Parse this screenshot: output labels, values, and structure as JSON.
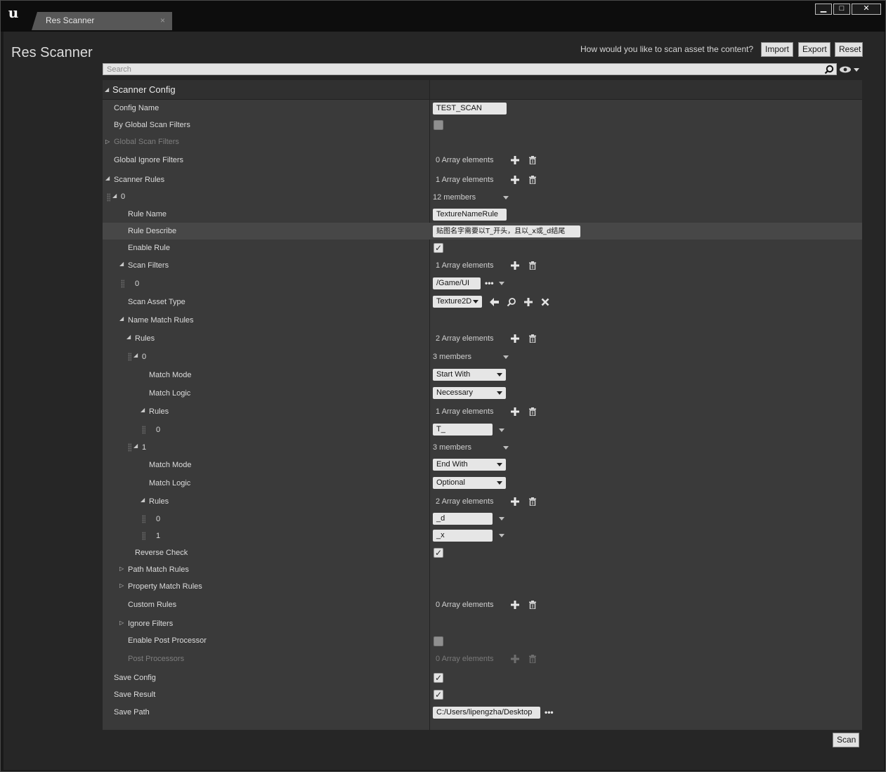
{
  "window": {
    "tab_title": "Res Scanner",
    "tab_close": "×",
    "controls": {
      "minimize": "▁",
      "maximize": "□",
      "close": "✕"
    },
    "logo": "u"
  },
  "header": {
    "title": "Res Scanner",
    "question": "How would you like to scan asset the content?",
    "import_label": "Import",
    "export_label": "Export",
    "reset_label": "Reset"
  },
  "search": {
    "placeholder": "Search",
    "value": ""
  },
  "panel": {
    "section_title": "Scanner Config",
    "config_name": {
      "label": "Config Name",
      "value": "TEST_SCAN"
    },
    "by_global_scan_filters": {
      "label": "By Global Scan Filters",
      "checked": false
    },
    "global_scan_filters": {
      "label": "Global Scan Filters"
    },
    "global_ignore_filters": {
      "label": "Global Ignore Filters",
      "value": "0 Array elements"
    },
    "scanner_rules": {
      "label": "Scanner Rules",
      "value": "1 Array elements"
    },
    "rule0": {
      "index": "0",
      "members": "12 members",
      "rule_name": {
        "label": "Rule Name",
        "value": "TextureNameRule"
      },
      "rule_describe": {
        "label": "Rule Describe",
        "value": "贴图名字需要以T_开头，且以_x或_d结尾"
      },
      "enable_rule": {
        "label": "Enable Rule",
        "checked": true
      },
      "scan_filters": {
        "label": "Scan Filters",
        "value": "1 Array elements",
        "item_index": "0",
        "item_value": "/Game/UI"
      },
      "scan_asset_type": {
        "label": "Scan Asset Type",
        "value": "Texture2D"
      },
      "name_match_rules": {
        "label": "Name Match Rules",
        "rules_label": "Rules",
        "rules_value": "2 Array elements",
        "items": [
          {
            "index": "0",
            "members": "3 members",
            "match_mode_label": "Match Mode",
            "match_mode": "Start With",
            "match_logic_label": "Match Logic",
            "match_logic": "Necessary",
            "rules_label": "Rules",
            "rules_value": "1 Array elements",
            "rules": [
              {
                "index": "0",
                "value": "T_"
              }
            ]
          },
          {
            "index": "1",
            "members": "3 members",
            "match_mode_label": "Match Mode",
            "match_mode": "End With",
            "match_logic_label": "Match Logic",
            "match_logic": "Optional",
            "rules_label": "Rules",
            "rules_value": "2 Array elements",
            "rules": [
              {
                "index": "0",
                "value": "_d"
              },
              {
                "index": "1",
                "value": "_x"
              }
            ]
          }
        ],
        "reverse_check": {
          "label": "Reverse Check",
          "checked": true
        }
      },
      "path_match_rules": {
        "label": "Path Match Rules"
      },
      "property_match_rules": {
        "label": "Property Match Rules"
      },
      "custom_rules": {
        "label": "Custom Rules",
        "value": "0 Array elements"
      },
      "ignore_filters": {
        "label": "Ignore Filters"
      },
      "enable_post_processor": {
        "label": "Enable Post Processor",
        "checked": false
      },
      "post_processors": {
        "label": "Post Processors",
        "value": "0 Array elements"
      }
    },
    "save_config": {
      "label": "Save Config",
      "checked": true
    },
    "save_result": {
      "label": "Save Result",
      "checked": true
    },
    "save_path": {
      "label": "Save Path",
      "value": "C:/Users/lipengzha/Desktop"
    }
  },
  "footer": {
    "scan_label": "Scan"
  },
  "glyphs": {
    "ellipsis": "•••",
    "check": "✓",
    "tri_open": "◢",
    "tri_closed": "▷"
  },
  "colors": {
    "background": "#262626",
    "panel": "#3a3a3a",
    "highlight_row": "#474747",
    "field": "#e6e6e6"
  }
}
